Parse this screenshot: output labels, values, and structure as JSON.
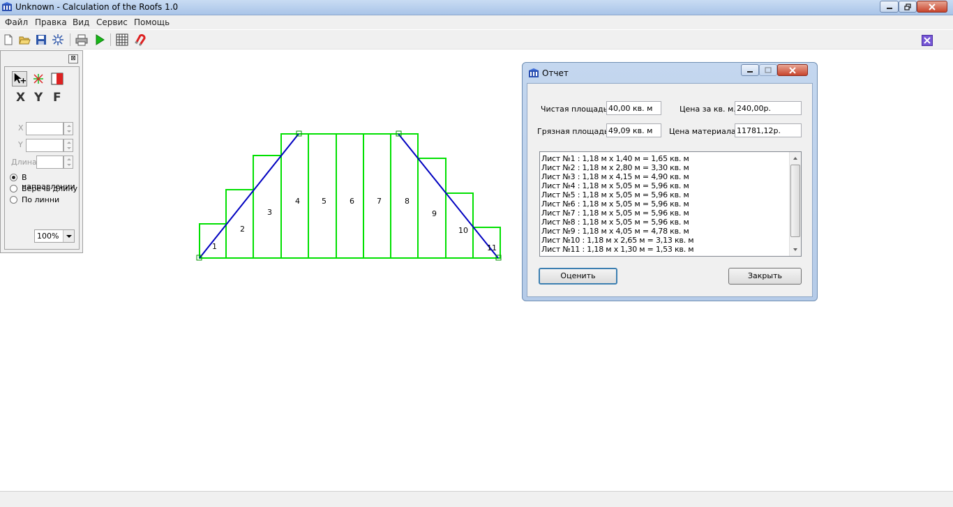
{
  "window": {
    "title": "Unknown - Calculation of the Roofs 1.0"
  },
  "menubar": {
    "items": [
      "Файл",
      "Правка",
      "Вид",
      "Сервис",
      "Помощь"
    ]
  },
  "toolbar": {
    "icons": [
      "new-icon",
      "open-icon",
      "save-icon",
      "wand-icon",
      "print-icon",
      "run-icon",
      "grid-icon",
      "magnet-icon"
    ],
    "close_icon": "close-icon"
  },
  "tool_panel": {
    "close_glyph": "⊠",
    "axis_letters": [
      "X",
      "Y",
      "F"
    ],
    "x_label": "X",
    "y_label": "Y",
    "length_label": "Длина",
    "x_value": "",
    "y_value": "",
    "length_value": "",
    "radios": [
      {
        "label": "В направлении",
        "checked": true
      },
      {
        "label": "Беречь длину",
        "checked": false
      },
      {
        "label": "По линни",
        "checked": false
      }
    ],
    "zoom": "100%"
  },
  "roof": {
    "sheet_labels": [
      "1",
      "2",
      "3",
      "4",
      "5",
      "6",
      "7",
      "8",
      "9",
      "10",
      "11"
    ],
    "outline_color": "#00e000",
    "line_color": "#0000c0"
  },
  "dialog": {
    "title": "Отчет",
    "net_area_label": "Чистая площадь:",
    "net_area_value": "40,00 кв. м",
    "price_per_m_label": "Цена за кв. м.:",
    "price_per_m_value": "240,00р.",
    "gross_area_label": "Грязная площадь:",
    "gross_area_value": "49,09 кв. м",
    "material_price_label": "Цена материала:",
    "material_price_value": "11781,12р.",
    "sheets": [
      "Лист №1 : 1,18 м x 1,40 м = 1,65 кв. м",
      "Лист №2 : 1,18 м x 2,80 м = 3,30 кв. м",
      "Лист №3 : 1,18 м x 4,15 м = 4,90 кв. м",
      "Лист №4 : 1,18 м x 5,05 м = 5,96 кв. м",
      "Лист №5 : 1,18 м x 5,05 м = 5,96 кв. м",
      "Лист №6 : 1,18 м x 5,05 м = 5,96 кв. м",
      "Лист №7 : 1,18 м x 5,05 м = 5,96 кв. м",
      "Лист №8 : 1,18 м x 5,05 м = 5,96 кв. м",
      "Лист №9 : 1,18 м x 4,05 м = 4,78 кв. м",
      "Лист №10 : 1,18 м x 2,65 м = 3,13 кв. м",
      "Лист №11 : 1,18 м x 1,30 м = 1,53 кв. м"
    ],
    "evaluate_button": "Оценить",
    "close_button": "Закрыть"
  }
}
